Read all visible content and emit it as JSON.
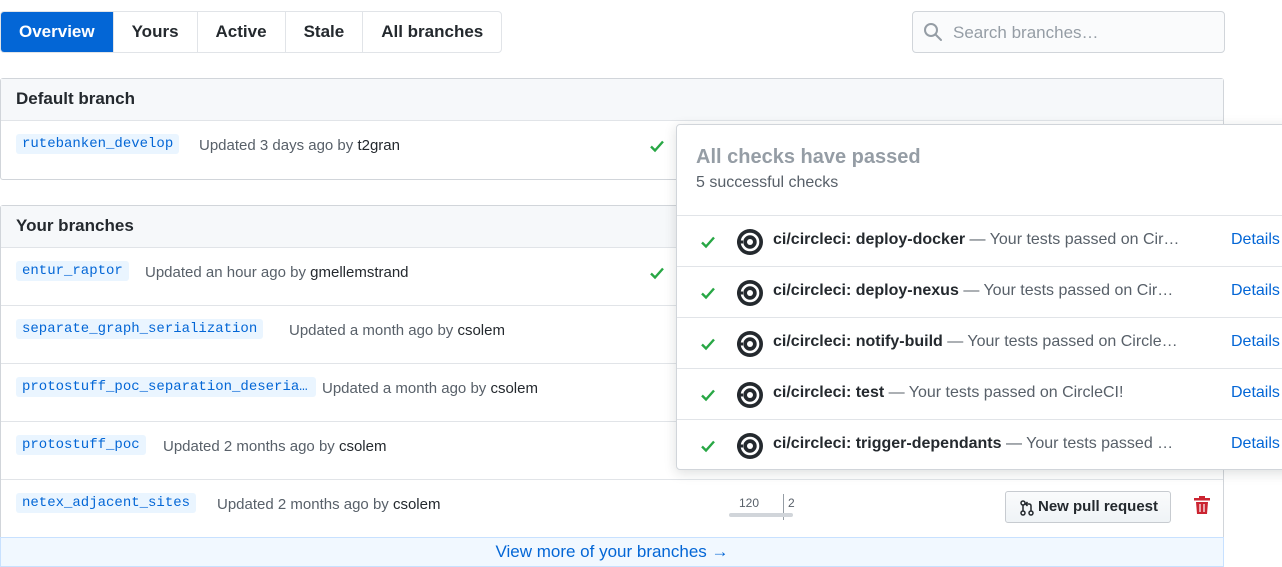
{
  "tabs": [
    {
      "label": "Overview",
      "active": true
    },
    {
      "label": "Yours",
      "active": false
    },
    {
      "label": "Active",
      "active": false
    },
    {
      "label": "Stale",
      "active": false
    },
    {
      "label": "All branches",
      "active": false
    }
  ],
  "search": {
    "placeholder": "Search branches…",
    "value": ""
  },
  "default_section": {
    "title": "Default branch",
    "branches": [
      {
        "name": "rutebanken_develop",
        "updated": "Updated 3 days ago by",
        "author": "t2gran"
      }
    ]
  },
  "your_section": {
    "title": "Your branches",
    "branches": [
      {
        "name": "entur_raptor",
        "updated": "Updated an hour ago by",
        "author": "gmellemstrand"
      },
      {
        "name": "separate_graph_serialization",
        "updated": "Updated a month ago by",
        "author": "csolem"
      },
      {
        "name": "protostuff_poc_separation_deserialization",
        "updated": "Updated a month ago by",
        "author": "csolem"
      },
      {
        "name": "protostuff_poc",
        "updated": "Updated 2 months ago by",
        "author": "csolem"
      },
      {
        "name": "netex_adjacent_sites",
        "updated": "Updated 2 months ago by",
        "author": "csolem",
        "behind": "120",
        "ahead": "2",
        "new_pr_label": "New pull request"
      }
    ],
    "view_more": "View more of your branches →"
  },
  "popover": {
    "title": "All checks have passed",
    "subtitle": "5 successful checks",
    "checks": [
      {
        "name": "ci/circleci: deploy-docker",
        "desc": "— Your tests passed on CircleCI!",
        "details": "Details"
      },
      {
        "name": "ci/circleci: deploy-nexus",
        "desc": "— Your tests passed on CircleCI!",
        "details": "Details"
      },
      {
        "name": "ci/circleci: notify-build",
        "desc": "— Your tests passed on CircleCI!",
        "details": "Details"
      },
      {
        "name": "ci/circleci: test",
        "desc": "— Your tests passed on CircleCI!",
        "details": "Details"
      },
      {
        "name": "ci/circleci: trigger-dependants",
        "desc": "— Your tests passed on CircleCI!",
        "details": "Details"
      }
    ]
  },
  "colors": {
    "primary": "#0366d6",
    "success": "#28a745",
    "danger": "#cb2431"
  },
  "icons": {
    "search": "search-icon",
    "check": "check-icon",
    "circleci": "circleci-logo-icon",
    "pull_request": "git-pull-request-icon",
    "trash": "trash-icon"
  }
}
